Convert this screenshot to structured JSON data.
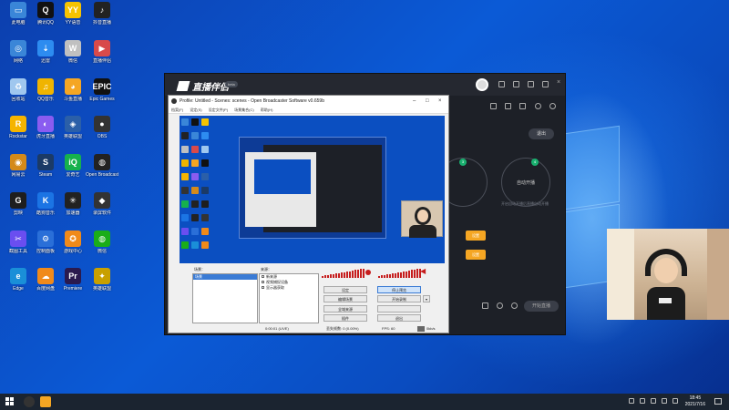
{
  "desktop_icons": [
    {
      "label": "此电脑",
      "color": "#3a86d8",
      "glyph": "▭"
    },
    {
      "label": "腾讯QQ",
      "color": "#111111",
      "glyph": "Q"
    },
    {
      "label": "YY语音",
      "color": "#f6c300",
      "glyph": "YY"
    },
    {
      "label": "抖音直播",
      "color": "#222222",
      "glyph": "♪"
    },
    {
      "label": "网络",
      "color": "#3a86d8",
      "glyph": "◎"
    },
    {
      "label": "迅雷",
      "color": "#2d8cf0",
      "glyph": "⇣"
    },
    {
      "label": "微信",
      "color": "#c0c0c0",
      "glyph": "W"
    },
    {
      "label": "直播伴侣",
      "color": "#d84a4a",
      "glyph": "▶"
    },
    {
      "label": "回收站",
      "color": "#9fc7ef",
      "glyph": "♻"
    },
    {
      "label": "QQ音乐",
      "color": "#f0b400",
      "glyph": "♫"
    },
    {
      "label": "斗鱼直播",
      "color": "#f5a623",
      "glyph": "◕"
    },
    {
      "label": "Epic Games",
      "color": "#111111",
      "glyph": "EPIC"
    },
    {
      "label": "Rockstar",
      "color": "#f5b400",
      "glyph": "R"
    },
    {
      "label": "虎牙直播",
      "color": "#8a5cf0",
      "glyph": "◐"
    },
    {
      "label": "英雄联盟",
      "color": "#2b5fa8",
      "glyph": "◈"
    },
    {
      "label": "OBS",
      "color": "#333333",
      "glyph": "●"
    },
    {
      "label": "网易云",
      "color": "#d48a1a",
      "glyph": "◉"
    },
    {
      "label": "Steam",
      "color": "#1b3a66",
      "glyph": "S"
    },
    {
      "label": "爱奇艺",
      "color": "#16b14d",
      "glyph": "iQ"
    },
    {
      "label": "Open Broadcaster",
      "color": "#222222",
      "glyph": "◍"
    },
    {
      "label": "剪映",
      "color": "#1e1e1e",
      "glyph": "G"
    },
    {
      "label": "酷狗音乐",
      "color": "#1b74e4",
      "glyph": "K"
    },
    {
      "label": "加速器",
      "color": "#222222",
      "glyph": "✳"
    },
    {
      "label": "录屏软件",
      "color": "#333333",
      "glyph": "◆"
    },
    {
      "label": "截图工具",
      "color": "#6a4ef0",
      "glyph": "✂"
    },
    {
      "label": "控制面板",
      "color": "#2a6fd8",
      "glyph": "⚙"
    },
    {
      "label": "游戏中心",
      "color": "#f08a1a",
      "glyph": "✪"
    },
    {
      "label": "微信",
      "color": "#1aad19",
      "glyph": "◍"
    },
    {
      "label": "Edge",
      "color": "#1a8fd8",
      "glyph": "e"
    },
    {
      "label": "百度网盘",
      "color": "#f08a1a",
      "glyph": "☁"
    },
    {
      "label": "Premiere",
      "color": "#2a1a4e",
      "glyph": "Pr"
    },
    {
      "label": "英雄联盟",
      "color": "#c8a000",
      "glyph": "✦"
    }
  ],
  "companion": {
    "version_badge": "beta",
    "exit_label": "退出",
    "circle_right_label": "自动开播",
    "circle_right_badge": "4",
    "circle_left_badge": "3",
    "hint_text": "开启自动开播后直播自动开播",
    "orange_a": "设置",
    "orange_b": "设置",
    "stream_button": "开始直播"
  },
  "obs": {
    "title": "Profile: Untitled - Scenes: scenes - Open Broadcaster Software v0.659b",
    "menu": [
      "档案(F)",
      "设定(S)",
      "设定文件(P)",
      "场景集合(C)",
      "帮助(H)"
    ],
    "scenes_label": "场景：",
    "sources_label": "来源：",
    "scene_items": [
      "场景"
    ],
    "sources": [
      "新来源",
      "视频捕捉设备",
      "显示器获取"
    ],
    "buttons": {
      "settings": "设定",
      "stop_preview": "停止预览",
      "edit_scene": "编辑场景",
      "start_record": "开始录制",
      "global_sources": "全域来源",
      "plugins": "插件",
      "exit": "退出"
    },
    "status_time": "0:00:01 (LIVE)",
    "status_dropped": "丢失帧数: 0 (0.00%)",
    "status_fps": "FPS: 60",
    "status_bitrate": "0kb/s"
  },
  "taskbar": {
    "time": "18:45",
    "date": "2021/7/16"
  }
}
